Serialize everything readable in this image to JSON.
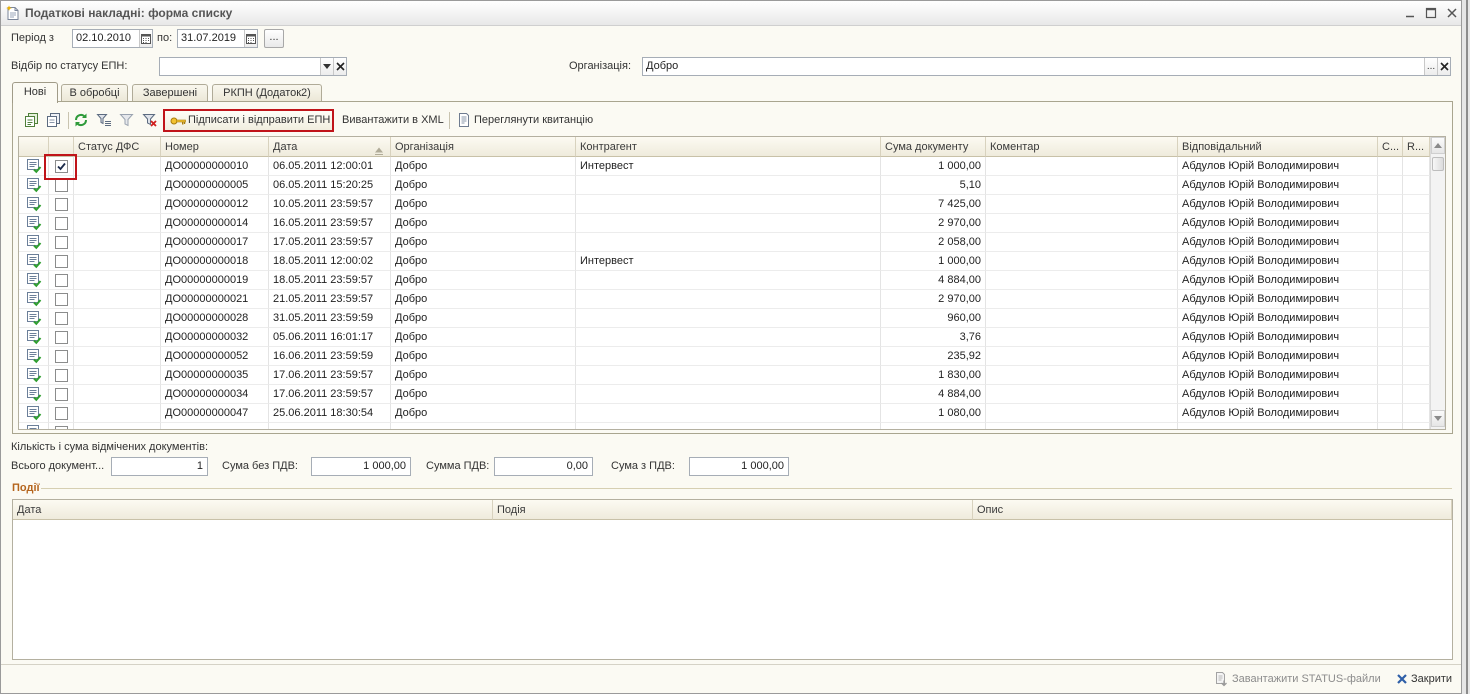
{
  "window": {
    "title": "Податкові накладні: форма списку"
  },
  "period": {
    "from_label": "Період з",
    "from_value": "02.10.2010",
    "to_label": "по:",
    "to_value": "31.07.2019",
    "choose_label": "..."
  },
  "status_filter": {
    "label": "Відбір по статусу ЕПН:"
  },
  "organization": {
    "label": "Організація:",
    "value": "Добро",
    "choose_label": "..."
  },
  "tabs": [
    {
      "label": "Нові",
      "active": true
    },
    {
      "label": "В обробці",
      "active": false
    },
    {
      "label": "Завершені",
      "active": false
    },
    {
      "label": "РКПН (Додаток2)",
      "active": false
    }
  ],
  "toolbar": {
    "icons": [
      "add-by-copying-icon",
      "copy-icon",
      "refresh-icon",
      "filter-icon",
      "filter-by-value-icon",
      "clear-filter-icon",
      "key-icon",
      "receipt-icon"
    ],
    "sign_send_label": "Підписати і відправити ЕПН",
    "export_xml_label": "Вивантажити в XML",
    "view_receipt_label": "Переглянути квитанцію"
  },
  "table": {
    "columns": {
      "status": "Статус ДФС",
      "number": "Номер",
      "date": "Дата",
      "organization": "Організація",
      "counterparty": "Контрагент",
      "amount": "Сума документу",
      "comment": "Коментар",
      "responsible": "Відповідальний",
      "c": "С...",
      "r": "R..."
    },
    "sort": {
      "column": "date",
      "direction": "ascending"
    },
    "rows": [
      {
        "checked": true,
        "number": "ДО00000000010",
        "date": "06.05.2011 12:00:01",
        "organization": "Добро",
        "counterparty": "Интервест",
        "amount": "1 000,00",
        "responsible": "Абдулов Юрій Володимирович"
      },
      {
        "checked": false,
        "number": "ДО00000000005",
        "date": "06.05.2011 15:20:25",
        "organization": "Добро",
        "amount": "5,10",
        "responsible": "Абдулов Юрій Володимирович"
      },
      {
        "checked": false,
        "number": "ДО00000000012",
        "date": "10.05.2011 23:59:57",
        "organization": "Добро",
        "amount": "7 425,00",
        "responsible": "Абдулов Юрій Володимирович"
      },
      {
        "checked": false,
        "number": "ДО00000000014",
        "date": "16.05.2011 23:59:57",
        "organization": "Добро",
        "amount": "2 970,00",
        "responsible": "Абдулов Юрій Володимирович"
      },
      {
        "checked": false,
        "number": "ДО00000000017",
        "date": "17.05.2011 23:59:57",
        "organization": "Добро",
        "amount": "2 058,00",
        "responsible": "Абдулов Юрій Володимирович"
      },
      {
        "checked": false,
        "number": "ДО00000000018",
        "date": "18.05.2011 12:00:02",
        "organization": "Добро",
        "counterparty": "Интервест",
        "amount": "1 000,00",
        "responsible": "Абдулов Юрій Володимирович"
      },
      {
        "checked": false,
        "number": "ДО00000000019",
        "date": "18.05.2011 23:59:57",
        "organization": "Добро",
        "amount": "4 884,00",
        "responsible": "Абдулов Юрій Володимирович"
      },
      {
        "checked": false,
        "number": "ДО00000000021",
        "date": "21.05.2011 23:59:57",
        "organization": "Добро",
        "amount": "2 970,00",
        "responsible": "Абдулов Юрій Володимирович"
      },
      {
        "checked": false,
        "number": "ДО00000000028",
        "date": "31.05.2011 23:59:59",
        "organization": "Добро",
        "amount": "960,00",
        "responsible": "Абдулов Юрій Володимирович"
      },
      {
        "checked": false,
        "number": "ДО00000000032",
        "date": "05.06.2011 16:01:17",
        "organization": "Добро",
        "amount": "3,76",
        "responsible": "Абдулов Юрій Володимирович"
      },
      {
        "checked": false,
        "number": "ДО00000000052",
        "date": "16.06.2011 23:59:59",
        "organization": "Добро",
        "amount": "235,92",
        "responsible": "Абдулов Юрій Володимирович"
      },
      {
        "checked": false,
        "number": "ДО00000000035",
        "date": "17.06.2011 23:59:57",
        "organization": "Добро",
        "amount": "1 830,00",
        "responsible": "Абдулов Юрій Володимирович"
      },
      {
        "checked": false,
        "number": "ДО00000000034",
        "date": "17.06.2011 23:59:57",
        "organization": "Добро",
        "amount": "4 884,00",
        "responsible": "Абдулов Юрій Володимирович"
      },
      {
        "checked": false,
        "number": "ДО00000000047",
        "date": "25.06.2011 18:30:54",
        "organization": "Добро",
        "amount": "1 080,00",
        "responsible": "Абдулов Юрій Володимирович"
      }
    ]
  },
  "totals": {
    "title": "Кількість і сума відмічених документів:",
    "count_label": "Всього документ...",
    "count_value": "1",
    "sum_without_vat_label": "Сума без ПДВ:",
    "sum_without_vat_value": "1 000,00",
    "vat_label": "Сумма ПДВ:",
    "vat_value": "0,00",
    "sum_with_vat_label": "Сума з ПДВ:",
    "sum_with_vat_value": "1 000,00"
  },
  "events": {
    "title": "Події",
    "columns": {
      "date": "Дата",
      "event": "Подія",
      "description": "Опис"
    }
  },
  "footer": {
    "load_status_label": "Завантажити STATUS-файли",
    "close_label": "Закрити"
  },
  "colors": {
    "form_background": "#fbfaf3",
    "highlight_border": "#c0141a",
    "group_title": "#b5651d",
    "disabled_text": "#8c8c8c"
  }
}
